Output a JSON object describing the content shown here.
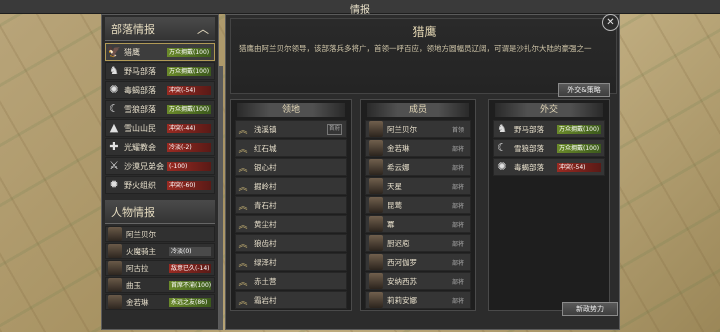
{
  "window_title": "情报",
  "tribe_section": {
    "title": "部落情报",
    "items": [
      {
        "name": "猎鹰",
        "relation": "万众拥戴(100)",
        "status": "good",
        "icon": "eagle-icon",
        "selected": true
      },
      {
        "name": "野马部落",
        "relation": "万众拥戴(100)",
        "status": "good",
        "icon": "horse-icon"
      },
      {
        "name": "毒蝎部落",
        "relation": "冲突(-54)",
        "status": "bad",
        "icon": "scorpion-icon"
      },
      {
        "name": "雪狼部落",
        "relation": "万众拥戴(100)",
        "status": "good",
        "icon": "wolf-icon"
      },
      {
        "name": "雪山山民",
        "relation": "冲突(-44)",
        "status": "bad",
        "icon": "mountain-icon"
      },
      {
        "name": "光耀教会",
        "relation": "冷淡(-2)",
        "status": "bad",
        "icon": "cross-icon"
      },
      {
        "name": "沙漠兄弟会",
        "relation": "(-100)",
        "status": "bad",
        "icon": "crossed-swords-icon"
      },
      {
        "name": "野火组织",
        "relation": "冲突(-60)",
        "status": "bad",
        "icon": "fire-icon"
      }
    ]
  },
  "character_section": {
    "title": "人物情报",
    "items": [
      {
        "name": "阿兰贝尔",
        "relation": "",
        "status": "neutral"
      },
      {
        "name": "火魔骑主",
        "relation": "冷淡(0)",
        "status": "neutral"
      },
      {
        "name": "阿古拉",
        "relation": "敌意已久(-14)",
        "status": "bad"
      },
      {
        "name": "曲玉",
        "relation": "首席不渝(100)",
        "status": "good"
      },
      {
        "name": "金若琳",
        "relation": "永远之友(86)",
        "status": "good"
      }
    ]
  },
  "detail": {
    "title": "猎鹰",
    "description": "猎鹰由阿兰贝尔领导，该部落兵多将广，首领一呼百应，领地方圆幅员辽阔，可谓是沙扎尔大陆的豪强之一",
    "diplomacy_button": "外交&策略",
    "territory": {
      "title": "领地",
      "items": [
        {
          "name": "浅溪镇",
          "tag": "首府"
        },
        {
          "name": "红石城"
        },
        {
          "name": "银心村"
        },
        {
          "name": "掘岭村"
        },
        {
          "name": "青石村"
        },
        {
          "name": "黄尘村"
        },
        {
          "name": "狼齿村"
        },
        {
          "name": "绿泽村"
        },
        {
          "name": "赤土营"
        },
        {
          "name": "霜岩村"
        }
      ]
    },
    "members": {
      "title": "成员",
      "items": [
        {
          "name": "阿兰贝尔",
          "role": "首领"
        },
        {
          "name": "金若琳",
          "role": "部将"
        },
        {
          "name": "希云娜",
          "role": "部将"
        },
        {
          "name": "天星",
          "role": "部将"
        },
        {
          "name": "昆莺",
          "role": "部将"
        },
        {
          "name": "冪",
          "role": "部将"
        },
        {
          "name": "厨迟庖",
          "role": "部将"
        },
        {
          "name": "西河伽罗",
          "role": "部将"
        },
        {
          "name": "安纳西苏",
          "role": "部将"
        },
        {
          "name": "莉莉安娜",
          "role": "部将"
        }
      ]
    },
    "diplomacy": {
      "title": "外交",
      "items": [
        {
          "name": "野马部落",
          "relation": "万众拥戴(100)",
          "status": "good",
          "icon": "horse-icon"
        },
        {
          "name": "雪狼部落",
          "relation": "万众拥戴(100)",
          "status": "good",
          "icon": "wolf-icon"
        },
        {
          "name": "毒蝎部落",
          "relation": "冲突(-54)",
          "status": "bad",
          "icon": "scorpion-icon"
        }
      ]
    }
  },
  "new_force_button": "新政势力",
  "colors": {
    "good": "#5a7d26",
    "bad": "#8a261f",
    "gold_border": "#b19a56"
  }
}
